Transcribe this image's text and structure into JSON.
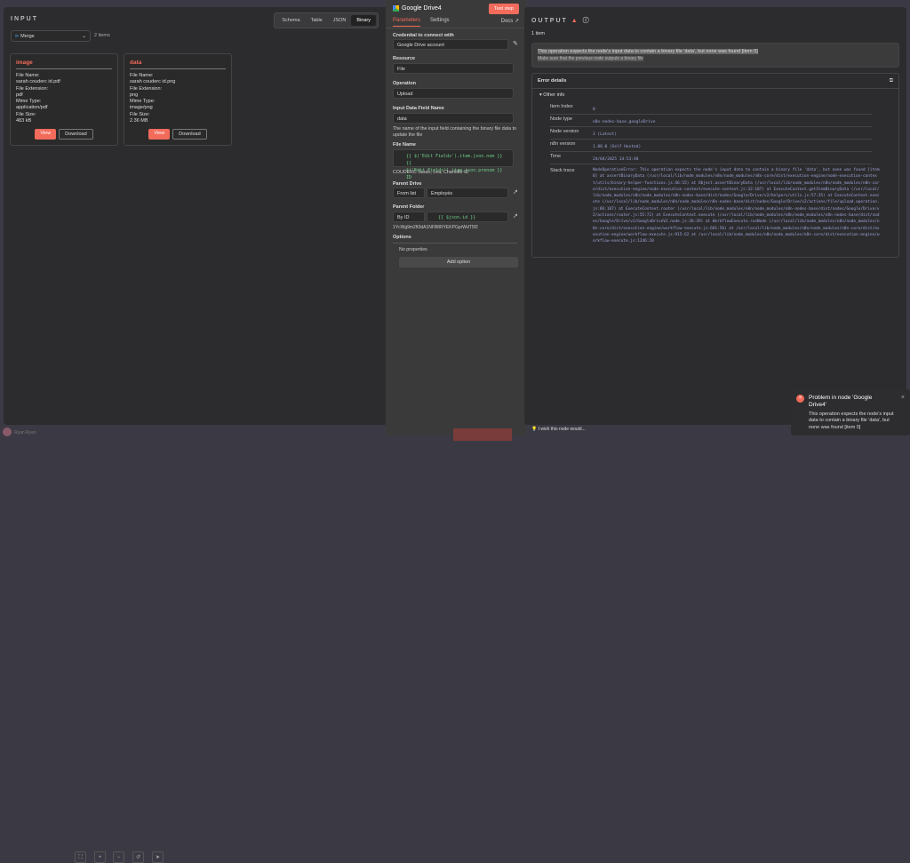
{
  "input": {
    "title": "INPUT",
    "tabs": [
      "Schema",
      "Table",
      "JSON",
      "Binary"
    ],
    "node": "Merge",
    "count": "2 items",
    "cards": [
      {
        "name": "image",
        "lines": [
          "File Name:",
          "sarah couderc id.pdf",
          "File Extension:",
          "pdf",
          "Mime Type:",
          "application/pdf",
          "File Size:",
          "483 kB"
        ]
      },
      {
        "name": "data",
        "lines": [
          "File Name:",
          "sarah couderc id.png",
          "File Extension:",
          "png",
          "Mime Type:",
          "image/png",
          "File Size:",
          "2.36 MB"
        ]
      }
    ],
    "view": "View",
    "download": "Download"
  },
  "node": {
    "title": "Google Drive4",
    "test": "Test step",
    "tabs": [
      "Parameters",
      "Settings"
    ],
    "docs": "Docs",
    "credential_label": "Credential to connect with",
    "credential": "Google Drive account",
    "resource_label": "Resource",
    "resource": "File",
    "operation_label": "Operation",
    "operation": "Upload",
    "field_label": "Input Data Field Name",
    "field": "data",
    "field_hint": "The name of the input field containing the binary file data to update the file",
    "filename_label": "File Name",
    "filename_expr1": "{{ $('Edit Fields').item.json.nom }} {{",
    "filename_expr2": "$('Edit Fields').item.json.prenom }} ID",
    "filename_preview": "COUDERC Sarah, Léa, Charlotte ID",
    "drive_label": "Parent Drive",
    "drive_mode": "From list",
    "drive": "Employés",
    "folder_label": "Parent Folder",
    "folder_mode": "By ID",
    "folder_expr": "{{ $json.id }}",
    "folder_preview": "1YcWg9m2ft3dA1NFB8RYEKPGprWdT5f2",
    "options_label": "Options",
    "no_props": "No properties",
    "add_option": "Add option"
  },
  "output": {
    "title": "OUTPUT",
    "count": "1 item",
    "error": "This operation expects the node's input data to contain a binary file 'data', but none was found [item 0]",
    "hint": "Make sure that the previous node outputs a binary file",
    "details": "Error details",
    "other": "Other info",
    "rows": [
      {
        "k": "Item Index",
        "v": "0"
      },
      {
        "k": "Node type",
        "v": "n8n-nodes-base.googleDrive"
      },
      {
        "k": "Node version",
        "v": "3 (Latest)"
      },
      {
        "k": "n8n version",
        "v": "1.88.0 (Self Hosted)"
      },
      {
        "k": "Time",
        "v": "24/04/2025 14:53:48"
      }
    ],
    "stack_label": "Stack trace",
    "stack": "NodeOperationError: This operation expects the node's input data to contain a binary file 'data', but none was found [item 0] at assertBinaryData (/usr/local/lib/node_modules/n8n/node_modules/n8n-core/dist/execution-engine/node-execution-context/utils/binary-helper-functions.js:46:15) at Object.assertBinaryData (/usr/local/lib/node_modules/n8n/node_modules/n8n-core/dist/execution-engine/node-execution-context/execute-context.js:32:107) at ExecuteContext.getItemBinaryData (/usr/local/lib/node_modules/n8n/node_modules/n8n-nodes-base/dist/nodes/Google/Drive/v2/helpers/utils.js:57:35) at ExecuteContext.execute (/usr/local/lib/node_modules/n8n/node_modules/n8n-nodes-base/dist/nodes/Google/Drive/v2/actions/file/upload.operation.js:86:107) at ExecuteContext.router (/usr/local/lib/node_modules/n8n/node_modules/n8n-nodes-base/dist/nodes/Google/Drive/v2/actions/router.js:55:72) at ExecuteContext.execute (/usr/local/lib/node_modules/n8n/node_modules/n8n-nodes-base/dist/nodes/Google/Drive/v2/GoogleDriveV2.node.js:36:39) at WorkflowExecute.runNode (/usr/local/lib/node_modules/n8n/node_modules/n8n-core/dist/execution-engine/workflow-execute.js:681:50) at /usr/local/lib/node_modules/n8n/node_modules/n8n-core/dist/execution-engine/workflow-execute.js:915:62 at /usr/local/lib/node_modules/n8n/node_modules/n8n-core/dist/execution-engine/workflow-execute.js:1246:20"
  },
  "footer": {
    "user": "Ryan Ryan",
    "feedback": "I wish this node would..."
  },
  "toast": {
    "title": "Problem in node 'Google Drive4'",
    "body": "This operation expects the node's input data to contain a binary file 'data', but none was found [item 0]"
  },
  "colors": {
    "accent": "#f26b5b"
  }
}
